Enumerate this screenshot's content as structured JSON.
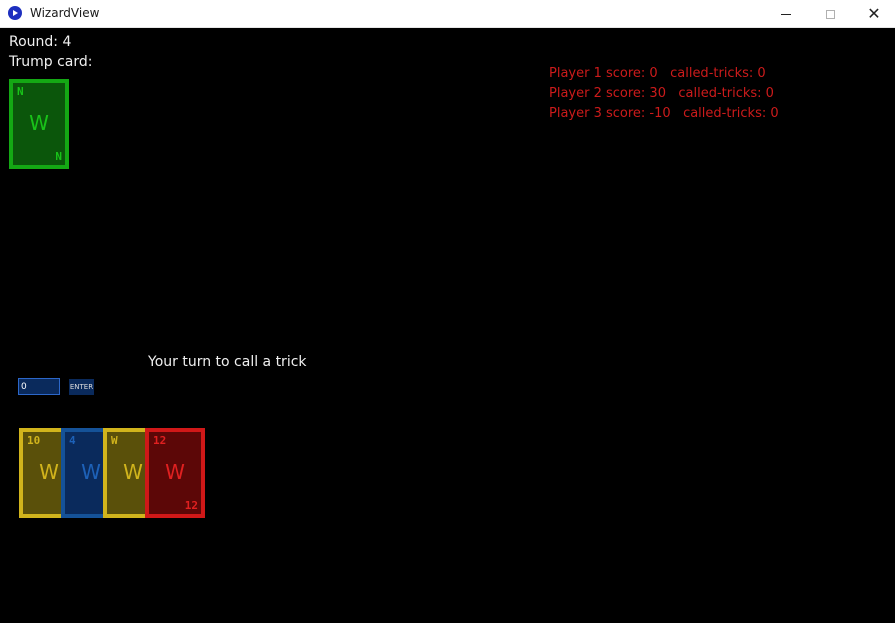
{
  "window": {
    "title": "WizardView"
  },
  "game": {
    "round_label": "Round: 4",
    "trump_label": "Trump card:",
    "trump_card": {
      "top_label": "N",
      "center_label": "W",
      "bottom_label": "N",
      "color": "#14a814"
    },
    "scores": [
      "Player 1 score: 0   called-tricks: 0",
      "Player 2 score: 30   called-tricks: 0",
      "Player 3 score: -10   called-tricks: 0"
    ],
    "prompt": "Your turn to call a trick",
    "call_input_value": "0",
    "enter_label": "ENTER",
    "hand": [
      {
        "top_label": "10",
        "center_label": "W",
        "bottom_label": "",
        "color": "#d1b41c"
      },
      {
        "top_label": "4",
        "center_label": "W",
        "bottom_label": "",
        "color": "#155298"
      },
      {
        "top_label": "W",
        "center_label": "W",
        "bottom_label": "",
        "color": "#d1b41c"
      },
      {
        "top_label": "12",
        "center_label": "W",
        "bottom_label": "12",
        "color": "#d01818"
      }
    ]
  }
}
